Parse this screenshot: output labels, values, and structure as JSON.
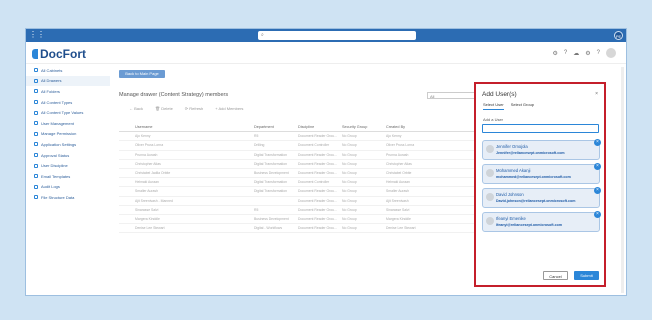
{
  "topbar": {
    "search_placeholder": "",
    "profile_initials": "PE"
  },
  "header": {
    "brand": "DocFort"
  },
  "sidebar": {
    "items": [
      {
        "label": "All Cabinets"
      },
      {
        "label": "All Drawers"
      },
      {
        "label": "All Folders"
      },
      {
        "label": "All Content Types"
      },
      {
        "label": "All Content Type Values"
      },
      {
        "label": "User Management"
      },
      {
        "label": "Manage Permission"
      },
      {
        "label": "Application Settings"
      },
      {
        "label": "Approval Status"
      },
      {
        "label": "User Discipline"
      },
      {
        "label": "Email Templates"
      },
      {
        "label": "Audit Logs"
      },
      {
        "label": "File Structure Data"
      }
    ]
  },
  "main": {
    "back_label": "Back to Main Page",
    "title": "Manage drawer (Content Strategy) members",
    "filter_value": "All",
    "actions": {
      "back": "Back",
      "delete": "Delete",
      "refresh": "Refresh",
      "add": "Add Members"
    },
    "columns": [
      "Username",
      "Department",
      "Discipline",
      "Security Group",
      "Created By"
    ],
    "rows": [
      [
        "Ajo Kenny",
        "R5",
        "Document Reader Grou...",
        "No Group",
        "Ajo Kenny"
      ],
      [
        "Oliver Pruss Lorna",
        "Drilling",
        "Document Controller",
        "No Group",
        "Oliver Pruss Lorna"
      ],
      [
        "Prunna Aurash",
        "Digital Transformation",
        "Document Reader Grou...",
        "No Group",
        "Prunna Aurash"
      ],
      [
        "Christopher Atlas",
        "Digital Transformation",
        "Document Reader Grou...",
        "No Group",
        "Christopher Atlas"
      ],
      [
        "Christabel Jadila Orbite",
        "Business Development",
        "Document Reader Grou...",
        "No Group",
        "Christabel Orbite"
      ],
      [
        "Helmaki Auraan",
        "Digital Transformation",
        "Document Controller",
        "No Group",
        "Helmaki Auraan"
      ],
      [
        "Smaller Aurash",
        "Digital Transformation",
        "Document Reader Grou...",
        "No Group",
        "Smaller Aurash"
      ],
      [
        "Ajit Sreenivash - Manned",
        "",
        "Document Reader Grou...",
        "No Group",
        "Ajit Sreenivash"
      ],
      [
        "Sinarasse Salvi",
        "R5",
        "Document Reader Grou...",
        "No Group",
        "Sinarasse Salvi"
      ],
      [
        "Margera Kinddle",
        "Business Development",
        "Document Reader Grou...",
        "No Group",
        "Margera Kinddle"
      ],
      [
        "Denise Lee Stewart",
        "Digital - Workflows",
        "Document Reader Grou...",
        "No Group",
        "Denise Lee Stewart"
      ]
    ]
  },
  "dialog": {
    "title": "Add User(s)",
    "close": "×",
    "tabs": [
      "Select User",
      "Select Group"
    ],
    "add_label": "Add a User",
    "input_value": "",
    "users": [
      {
        "name": "Jennifer Omojola",
        "email": "Jennifer@reliancesept.onmicrosoft.com"
      },
      {
        "name": "Mohammed Akanji",
        "email": "mohammed@reliancesept.onmicrosoft.com"
      },
      {
        "name": "David Johnson",
        "email": "David.johnson@reliancesept.onmicrosoft.com"
      },
      {
        "name": "Ifeanyi Emenike",
        "email": "Ifeanyi@reliancesept.onmicrosoft.com"
      }
    ],
    "cancel": "Cancel",
    "submit": "Submit"
  },
  "colors": {
    "accent": "#2b86d8",
    "topbar": "#2c6cb3",
    "highlight": "#c41f2b"
  }
}
